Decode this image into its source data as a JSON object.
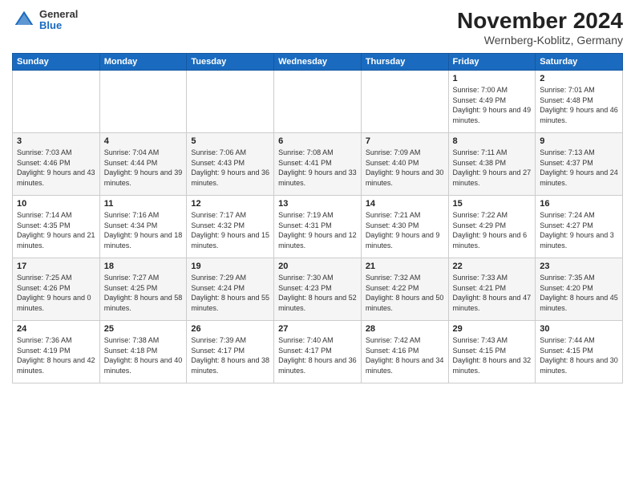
{
  "logo": {
    "general": "General",
    "blue": "Blue"
  },
  "title": "November 2024",
  "location": "Wernberg-Koblitz, Germany",
  "headers": [
    "Sunday",
    "Monday",
    "Tuesday",
    "Wednesday",
    "Thursday",
    "Friday",
    "Saturday"
  ],
  "weeks": [
    [
      {
        "day": "",
        "info": ""
      },
      {
        "day": "",
        "info": ""
      },
      {
        "day": "",
        "info": ""
      },
      {
        "day": "",
        "info": ""
      },
      {
        "day": "",
        "info": ""
      },
      {
        "day": "1",
        "info": "Sunrise: 7:00 AM\nSunset: 4:49 PM\nDaylight: 9 hours and 49 minutes."
      },
      {
        "day": "2",
        "info": "Sunrise: 7:01 AM\nSunset: 4:48 PM\nDaylight: 9 hours and 46 minutes."
      }
    ],
    [
      {
        "day": "3",
        "info": "Sunrise: 7:03 AM\nSunset: 4:46 PM\nDaylight: 9 hours and 43 minutes."
      },
      {
        "day": "4",
        "info": "Sunrise: 7:04 AM\nSunset: 4:44 PM\nDaylight: 9 hours and 39 minutes."
      },
      {
        "day": "5",
        "info": "Sunrise: 7:06 AM\nSunset: 4:43 PM\nDaylight: 9 hours and 36 minutes."
      },
      {
        "day": "6",
        "info": "Sunrise: 7:08 AM\nSunset: 4:41 PM\nDaylight: 9 hours and 33 minutes."
      },
      {
        "day": "7",
        "info": "Sunrise: 7:09 AM\nSunset: 4:40 PM\nDaylight: 9 hours and 30 minutes."
      },
      {
        "day": "8",
        "info": "Sunrise: 7:11 AM\nSunset: 4:38 PM\nDaylight: 9 hours and 27 minutes."
      },
      {
        "day": "9",
        "info": "Sunrise: 7:13 AM\nSunset: 4:37 PM\nDaylight: 9 hours and 24 minutes."
      }
    ],
    [
      {
        "day": "10",
        "info": "Sunrise: 7:14 AM\nSunset: 4:35 PM\nDaylight: 9 hours and 21 minutes."
      },
      {
        "day": "11",
        "info": "Sunrise: 7:16 AM\nSunset: 4:34 PM\nDaylight: 9 hours and 18 minutes."
      },
      {
        "day": "12",
        "info": "Sunrise: 7:17 AM\nSunset: 4:32 PM\nDaylight: 9 hours and 15 minutes."
      },
      {
        "day": "13",
        "info": "Sunrise: 7:19 AM\nSunset: 4:31 PM\nDaylight: 9 hours and 12 minutes."
      },
      {
        "day": "14",
        "info": "Sunrise: 7:21 AM\nSunset: 4:30 PM\nDaylight: 9 hours and 9 minutes."
      },
      {
        "day": "15",
        "info": "Sunrise: 7:22 AM\nSunset: 4:29 PM\nDaylight: 9 hours and 6 minutes."
      },
      {
        "day": "16",
        "info": "Sunrise: 7:24 AM\nSunset: 4:27 PM\nDaylight: 9 hours and 3 minutes."
      }
    ],
    [
      {
        "day": "17",
        "info": "Sunrise: 7:25 AM\nSunset: 4:26 PM\nDaylight: 9 hours and 0 minutes."
      },
      {
        "day": "18",
        "info": "Sunrise: 7:27 AM\nSunset: 4:25 PM\nDaylight: 8 hours and 58 minutes."
      },
      {
        "day": "19",
        "info": "Sunrise: 7:29 AM\nSunset: 4:24 PM\nDaylight: 8 hours and 55 minutes."
      },
      {
        "day": "20",
        "info": "Sunrise: 7:30 AM\nSunset: 4:23 PM\nDaylight: 8 hours and 52 minutes."
      },
      {
        "day": "21",
        "info": "Sunrise: 7:32 AM\nSunset: 4:22 PM\nDaylight: 8 hours and 50 minutes."
      },
      {
        "day": "22",
        "info": "Sunrise: 7:33 AM\nSunset: 4:21 PM\nDaylight: 8 hours and 47 minutes."
      },
      {
        "day": "23",
        "info": "Sunrise: 7:35 AM\nSunset: 4:20 PM\nDaylight: 8 hours and 45 minutes."
      }
    ],
    [
      {
        "day": "24",
        "info": "Sunrise: 7:36 AM\nSunset: 4:19 PM\nDaylight: 8 hours and 42 minutes."
      },
      {
        "day": "25",
        "info": "Sunrise: 7:38 AM\nSunset: 4:18 PM\nDaylight: 8 hours and 40 minutes."
      },
      {
        "day": "26",
        "info": "Sunrise: 7:39 AM\nSunset: 4:17 PM\nDaylight: 8 hours and 38 minutes."
      },
      {
        "day": "27",
        "info": "Sunrise: 7:40 AM\nSunset: 4:17 PM\nDaylight: 8 hours and 36 minutes."
      },
      {
        "day": "28",
        "info": "Sunrise: 7:42 AM\nSunset: 4:16 PM\nDaylight: 8 hours and 34 minutes."
      },
      {
        "day": "29",
        "info": "Sunrise: 7:43 AM\nSunset: 4:15 PM\nDaylight: 8 hours and 32 minutes."
      },
      {
        "day": "30",
        "info": "Sunrise: 7:44 AM\nSunset: 4:15 PM\nDaylight: 8 hours and 30 minutes."
      }
    ]
  ]
}
